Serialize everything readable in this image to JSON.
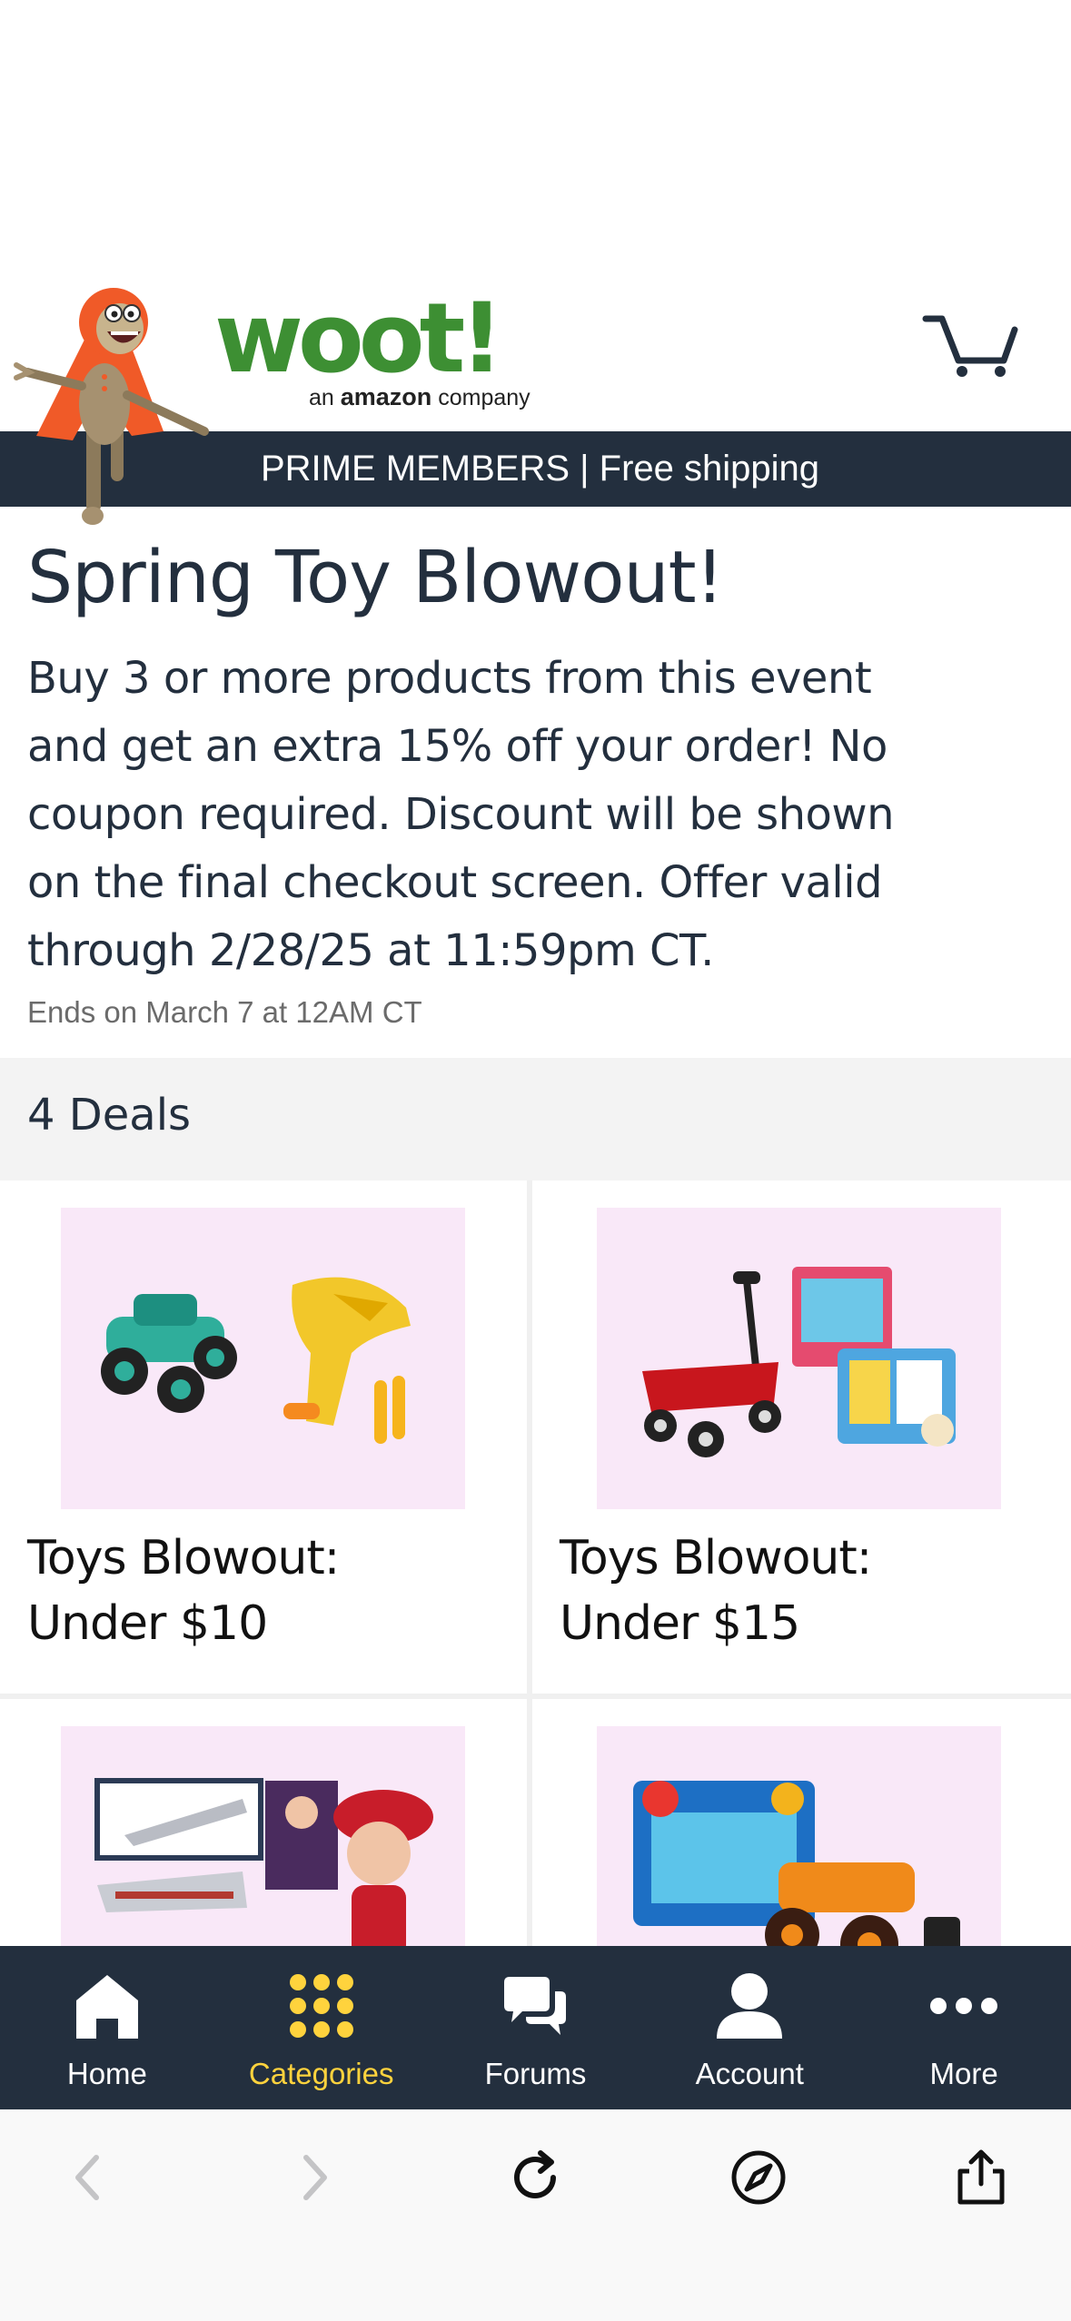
{
  "header": {
    "logo_word": "woot!",
    "logo_sub_prefix": "an ",
    "logo_sub_brand": "amazon",
    "logo_sub_suffix": " company",
    "banner": "PRIME MEMBERS | Free shipping"
  },
  "event": {
    "title": "Spring Toy Blowout!",
    "description": "Buy 3 or more products from this event and get an extra 15% off your order! No coupon required. Discount will be shown on the final checkout screen. Offer valid through 2/28/25 at 11:59pm CT.",
    "ends": "Ends on March 7 at 12AM CT"
  },
  "deals": {
    "count_label": "4 Deals",
    "items": [
      {
        "title": "Toys Blowout: Under $10"
      },
      {
        "title": "Toys Blowout: Under $15"
      },
      {
        "title": ""
      },
      {
        "title": ""
      }
    ]
  },
  "tabbar": {
    "tabs": [
      {
        "label": "Home",
        "icon": "home-icon",
        "active": false
      },
      {
        "label": "Categories",
        "icon": "categories-icon",
        "active": true
      },
      {
        "label": "Forums",
        "icon": "forums-icon",
        "active": false
      },
      {
        "label": "Account",
        "icon": "account-icon",
        "active": false
      },
      {
        "label": "More",
        "icon": "more-icon",
        "active": false
      }
    ]
  },
  "browser": {
    "buttons": [
      "back-icon",
      "forward-icon",
      "reload-icon",
      "compass-icon",
      "share-icon"
    ]
  },
  "colors": {
    "navy": "#232f3e",
    "brand_green": "#3d8f33",
    "active_tab": "#ffd33d",
    "thumb_bg": "#f9e8f8"
  }
}
